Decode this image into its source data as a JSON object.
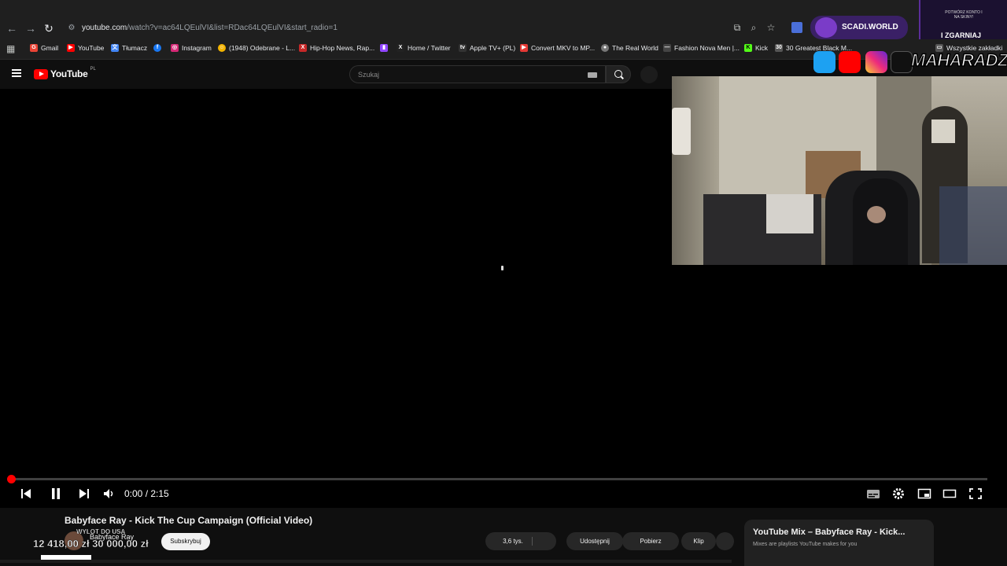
{
  "browser": {
    "url_main": "youtube.com",
    "url_rest": "/watch?v=ac64LQEulVI&list=RDac64LQEulVI&start_radio=1",
    "bookmarks": [
      {
        "label": "Gmail",
        "color": "#ea4335",
        "glyph": "G"
      },
      {
        "label": "YouTube",
        "color": "#ff0000",
        "glyph": "▶"
      },
      {
        "label": "Tłumacz",
        "color": "#4285f4",
        "glyph": "文"
      },
      {
        "label": "",
        "color": "#1877f2",
        "glyph": "f"
      },
      {
        "label": "Instagram",
        "color": "#d62976",
        "glyph": "◎"
      },
      {
        "label": "(1948) Odebrane - L...",
        "color": "#f4b400",
        "glyph": "☺"
      },
      {
        "label": "Hip-Hop News, Rap...",
        "color": "#c62828",
        "glyph": "X"
      },
      {
        "label": "",
        "color": "#9146ff",
        "glyph": "▮"
      },
      {
        "label": "Home / Twitter",
        "color": "#222222",
        "glyph": "X"
      },
      {
        "label": "Apple TV+ (PL)",
        "color": "#333333",
        "glyph": "tv"
      },
      {
        "label": "Convert MKV to MP...",
        "color": "#e53935",
        "glyph": "▶"
      },
      {
        "label": "The Real World",
        "color": "#777777",
        "glyph": "●"
      },
      {
        "label": "Fashion Nova Men |...",
        "color": "#444444",
        "glyph": "—"
      },
      {
        "label": "Kick",
        "color": "#53fc18",
        "glyph": "K"
      },
      {
        "label": "30 Greatest Black M...",
        "color": "#555555",
        "glyph": "30"
      },
      {
        "label": "Wszystkie zakładki",
        "color": "#555555",
        "glyph": "▭"
      }
    ]
  },
  "overlay": {
    "scadi": "SCADI.WORLD",
    "zgarniaj": "I ZGARNIAJ",
    "zg_small": "POTWÓRZ KONTO I NA SKINY!",
    "maharadzza": "MAHARADZZA",
    "social": [
      {
        "name": "twitter",
        "color": "#1da1f2"
      },
      {
        "name": "youtube",
        "color": "#ff0000"
      },
      {
        "name": "instagram",
        "color": "#c13584"
      },
      {
        "name": "tiktok",
        "color": "#111111"
      }
    ]
  },
  "youtube": {
    "logo": "YouTube",
    "country": "PL",
    "search_placeholder": "Szukaj"
  },
  "player": {
    "time": "0:00 / 2:15",
    "progress": 0
  },
  "video_info": {
    "title": "Babyface Ray - Kick The Cup Campaign (Official Video)",
    "channel": "Babyface Ray",
    "subscribe": "Subskrybuj",
    "likes": "3,6 tys.",
    "share": "Udostępnij",
    "download": "Pobierz",
    "clip": "Klip"
  },
  "goal": {
    "label": "WYLOT DO USA",
    "amounts": "12 418,00 zł 30 000,00 zł"
  },
  "mix": {
    "title": "YouTube Mix – Babyface Ray - Kick...",
    "subtitle": "Mixes are playlists YouTube makes for you"
  }
}
